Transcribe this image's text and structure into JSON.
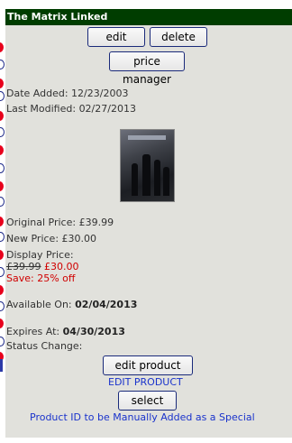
{
  "window": {
    "title": "The Matrix Linked"
  },
  "buttons": {
    "edit": "edit",
    "delete": "delete",
    "price_manager": "price manager",
    "edit_product": "edit product",
    "select": "select"
  },
  "dates": {
    "added_label": "Date Added:",
    "added_value": "12/23/2003",
    "modified_label": "Last Modified:",
    "modified_value": "02/27/2013"
  },
  "product_image": {
    "icon": "dvd-cover-image"
  },
  "prices": {
    "original_label": "Original Price:",
    "original_value": "£39.99",
    "new_label": "New Price:",
    "new_value": "£30.00",
    "display_label": "Display Price:",
    "display_old": "£39.99",
    "display_new": "£30.00",
    "save": "Save: 25% off"
  },
  "availability": {
    "available_label": "Available On:",
    "available_value": "02/04/2013",
    "expires_label": "Expires At:",
    "expires_value": "04/30/2013",
    "status_label": "Status Change:"
  },
  "links": {
    "edit_product": "EDIT PRODUCT",
    "manual_note": "Product ID to be Manually Added as a Special"
  },
  "colors": {
    "title_bar": "#003d00",
    "panel": "#e1e1dc",
    "sale_red": "#d00000",
    "link_blue": "#1a33cc"
  }
}
